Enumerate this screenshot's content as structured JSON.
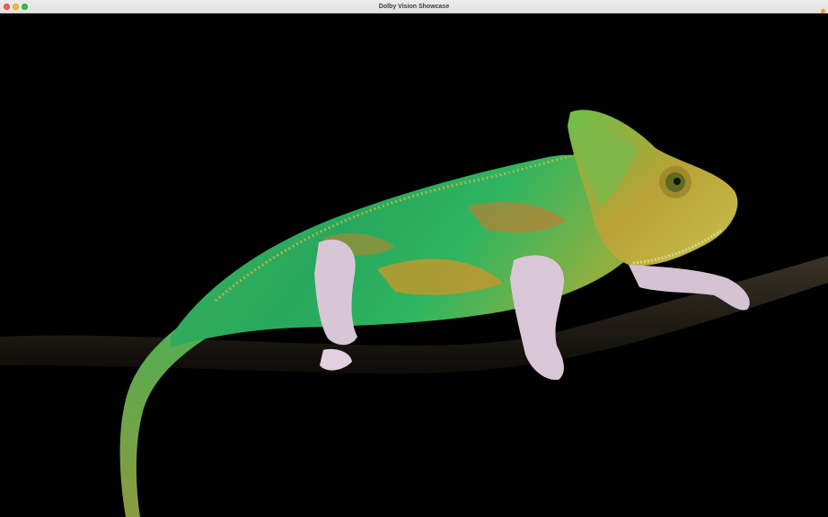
{
  "window": {
    "title": "Dolby Vision Showcase"
  },
  "titlebar_buttons": {
    "close": "close-button",
    "minimize": "minimize-button",
    "zoom": "zoom-button"
  },
  "colors": {
    "close": "#ff5f57",
    "minimize": "#febc2e",
    "zoom": "#28c840",
    "background": "#000000",
    "chameleon_body": "#2fae55",
    "chameleon_accent": "#c9962b",
    "branch": "#2a241c"
  },
  "content": {
    "subject": "chameleon-on-branch"
  }
}
